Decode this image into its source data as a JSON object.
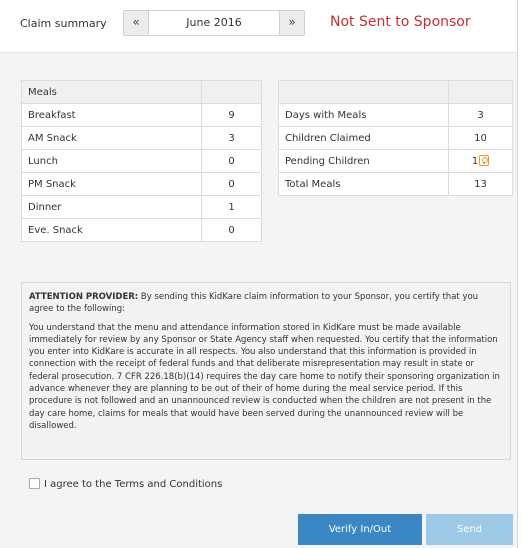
{
  "header": {
    "title": "Claim summary",
    "prev_glyph": "«",
    "month": "June 2016",
    "next_glyph": "»",
    "status": "Not Sent to Sponsor",
    "status_color": "#c62f2f"
  },
  "meals_table": {
    "header": "Meals",
    "rows": [
      {
        "label": "Breakfast",
        "value": "9"
      },
      {
        "label": "AM Snack",
        "value": "3"
      },
      {
        "label": "Lunch",
        "value": "0"
      },
      {
        "label": "PM Snack",
        "value": "0"
      },
      {
        "label": "Dinner",
        "value": "1"
      },
      {
        "label": "Eve. Snack",
        "value": "0"
      }
    ]
  },
  "summary_table": {
    "rows": [
      {
        "label": "Days with Meals",
        "value": "3"
      },
      {
        "label": "Children Claimed",
        "value": "10"
      },
      {
        "label": "Pending Children",
        "value": "1",
        "icon": "info-icon"
      },
      {
        "label": "Total Meals",
        "value": "13"
      }
    ]
  },
  "attention": {
    "heading": "ATTENTION PROVIDER:",
    "intro": " By sending this KidKare claim information to your Sponsor, you certify that you agree to the following:",
    "body": "You understand that the menu and attendance information stored in KidKare must be made available immediately for review by any Sponsor or State Agency staff when requested. You certify that the information you enter into KidKare is accurate in all respects. You also understand that this information is provided in connection with the receipt of federal funds and that deliberate misrepresentation may result in state or federal prosecution. 7 CFR 226.18(b)(14) requires the day care home to notify their sponsoring organization in advance whenever they are planning to be out of their of home during the meal service period. If this procedure is not followed and an unannounced review is conducted when the children are not present in the day care home, claims for meals that would have been served during the unannounced review will be disallowed."
  },
  "agree": {
    "label": "I agree to the Terms and Conditions",
    "checked": false
  },
  "buttons": {
    "verify": "Verify In/Out",
    "send": "Send"
  },
  "colors": {
    "primary_button": "#3a87c4",
    "disabled_button": "#9dc9e7"
  }
}
